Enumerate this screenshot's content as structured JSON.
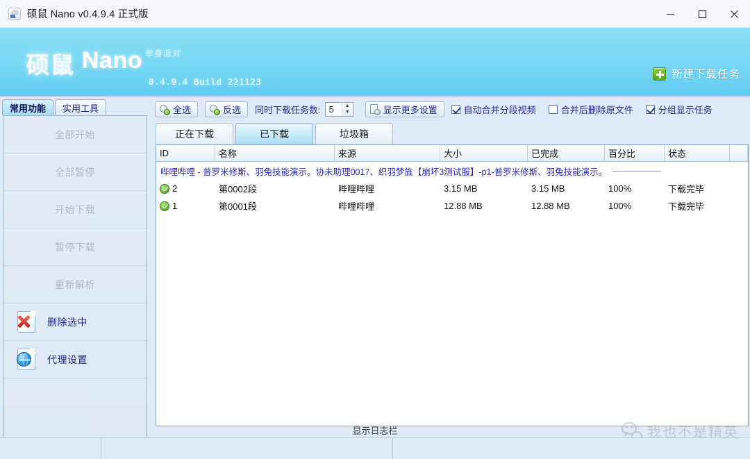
{
  "window": {
    "title": "硕鼠 Nano v0.4.9.4 正式版",
    "icon": "app-icon",
    "minimize": "–",
    "maximize": "□",
    "close": "✕"
  },
  "banner": {
    "logo_cn": "硕鼠",
    "logo_en": "Nano",
    "tagline": "单身派对",
    "build": "0.4.9.4 Build 221123",
    "new_task_label": "新建下载任务",
    "new_task_icon": "plus-icon",
    "gradient_top": "#8ddff6",
    "gradient_bottom": "#63cdf1"
  },
  "sidebar": {
    "tabs": [
      {
        "label": "常用功能",
        "active": true
      },
      {
        "label": "实用工具",
        "active": false
      }
    ],
    "items": [
      {
        "label": "全部开始",
        "icon": "",
        "disabled": true
      },
      {
        "label": "全部暂停",
        "icon": "",
        "disabled": true
      },
      {
        "label": "开始下载",
        "icon": "",
        "disabled": true
      },
      {
        "label": "暂停下载",
        "icon": "",
        "disabled": true
      },
      {
        "label": "重新解析",
        "icon": "",
        "disabled": true
      },
      {
        "label": "删除选中",
        "icon": "delete-file-icon",
        "disabled": false
      },
      {
        "label": "代理设置",
        "icon": "globe-icon",
        "disabled": false
      }
    ]
  },
  "toolbar": {
    "select_all_label": "全选",
    "select_all_icon": "gear-add-icon",
    "invert_label": "反选",
    "invert_icon": "gear-refresh-icon",
    "concurrent_label": "同时下载任务数:",
    "concurrent_value": "5",
    "spin_up": "▲",
    "spin_down": "▼",
    "more_settings_label": "显示更多设置",
    "more_settings_icon": "settings-doc-icon",
    "checkboxes": [
      {
        "label": "自动合并分段视频",
        "checked": true
      },
      {
        "label": "合并后删除原文件",
        "checked": false
      },
      {
        "label": "分组显示任务",
        "checked": true
      }
    ]
  },
  "tabs": [
    {
      "label": "正在下载",
      "active": false
    },
    {
      "label": "已下载",
      "active": true
    },
    {
      "label": "垃圾箱",
      "active": false
    }
  ],
  "table": {
    "columns": [
      "ID",
      "名称",
      "来源",
      "大小",
      "已完成",
      "百分比",
      "状态",
      ""
    ],
    "group_title": "哔哩哔哩 - 普罗米修斯、羽兔技能演示。协未助理0017、织羽梦旌【崩坏3测试服】-p1-普罗米修斯、羽兔技能演示。",
    "rows": [
      {
        "status_icon": "download-complete-icon",
        "id": "2",
        "name": "第0002段",
        "source": "哔哩哔哩",
        "size": "3.15 MB",
        "completed": "3.15 MB",
        "percent": "100%",
        "status": "下载完毕"
      },
      {
        "status_icon": "download-complete-icon",
        "id": "1",
        "name": "第0001段",
        "source": "哔哩哔哩",
        "size": "12.88 MB",
        "completed": "12.88 MB",
        "percent": "100%",
        "status": "下载完毕"
      }
    ]
  },
  "footer": {
    "log_link": "显示日志栏"
  },
  "watermark": {
    "text": "我也不是精英",
    "icon": "wechat-icon"
  }
}
